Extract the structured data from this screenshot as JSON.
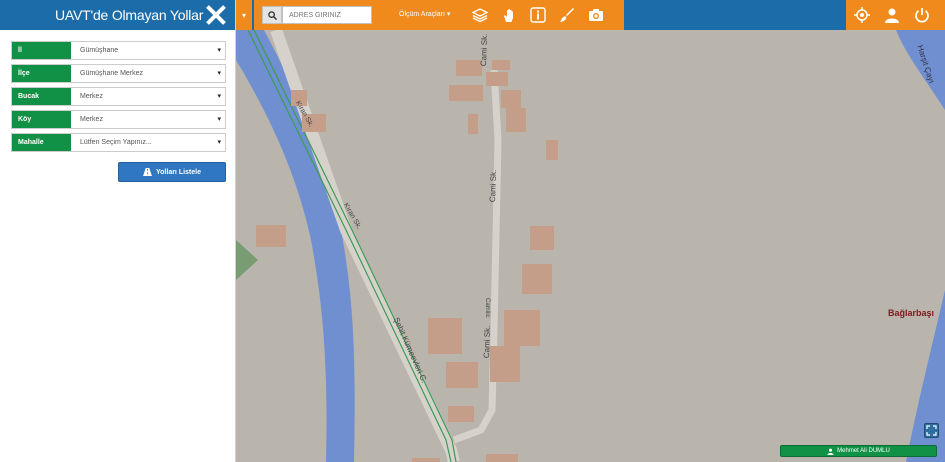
{
  "sidebar": {
    "title": "UAVT'de Olmayan Yollar",
    "filters": [
      {
        "label": "İl",
        "value": "Gümüşhane"
      },
      {
        "label": "İlçe",
        "value": "Gümüşhane Merkez"
      },
      {
        "label": "Bucak",
        "value": "Merkez"
      },
      {
        "label": "Köy",
        "value": "Merkez"
      },
      {
        "label": "Mahalle",
        "value": "Lütfen Seçim Yapınız..."
      }
    ],
    "list_button": "Yolları Listele"
  },
  "toolbar": {
    "search_placeholder": "ADRES GİRİNİZ",
    "measure_menu": "Ölçüm Araçları",
    "tools": [
      "layers-icon",
      "hand-icon",
      "info-icon",
      "brush-icon",
      "camera-icon"
    ],
    "right_tools": [
      "locate-icon",
      "user-icon",
      "power-icon"
    ]
  },
  "map": {
    "labels": {
      "cami_top": "Cami Sk.",
      "cami_mid": "Cami Sk.",
      "cami_low": "Cami Sk.",
      "cami_low2": "Camiiic",
      "kiran_top": "Kıran Sk.",
      "kiran_mid": "Kıran Sk.",
      "sehit": "Şehit Kümeevleri C.",
      "harsit": "Harşit Çayı",
      "place": "Bağlarbaşı"
    }
  },
  "user": {
    "name": "Mehmet Ali DUMLU"
  },
  "colors": {
    "header_blue": "#1b6ca8",
    "tool_orange": "#f08a1c",
    "label_green": "#119145",
    "river": "#6f8fd1"
  }
}
